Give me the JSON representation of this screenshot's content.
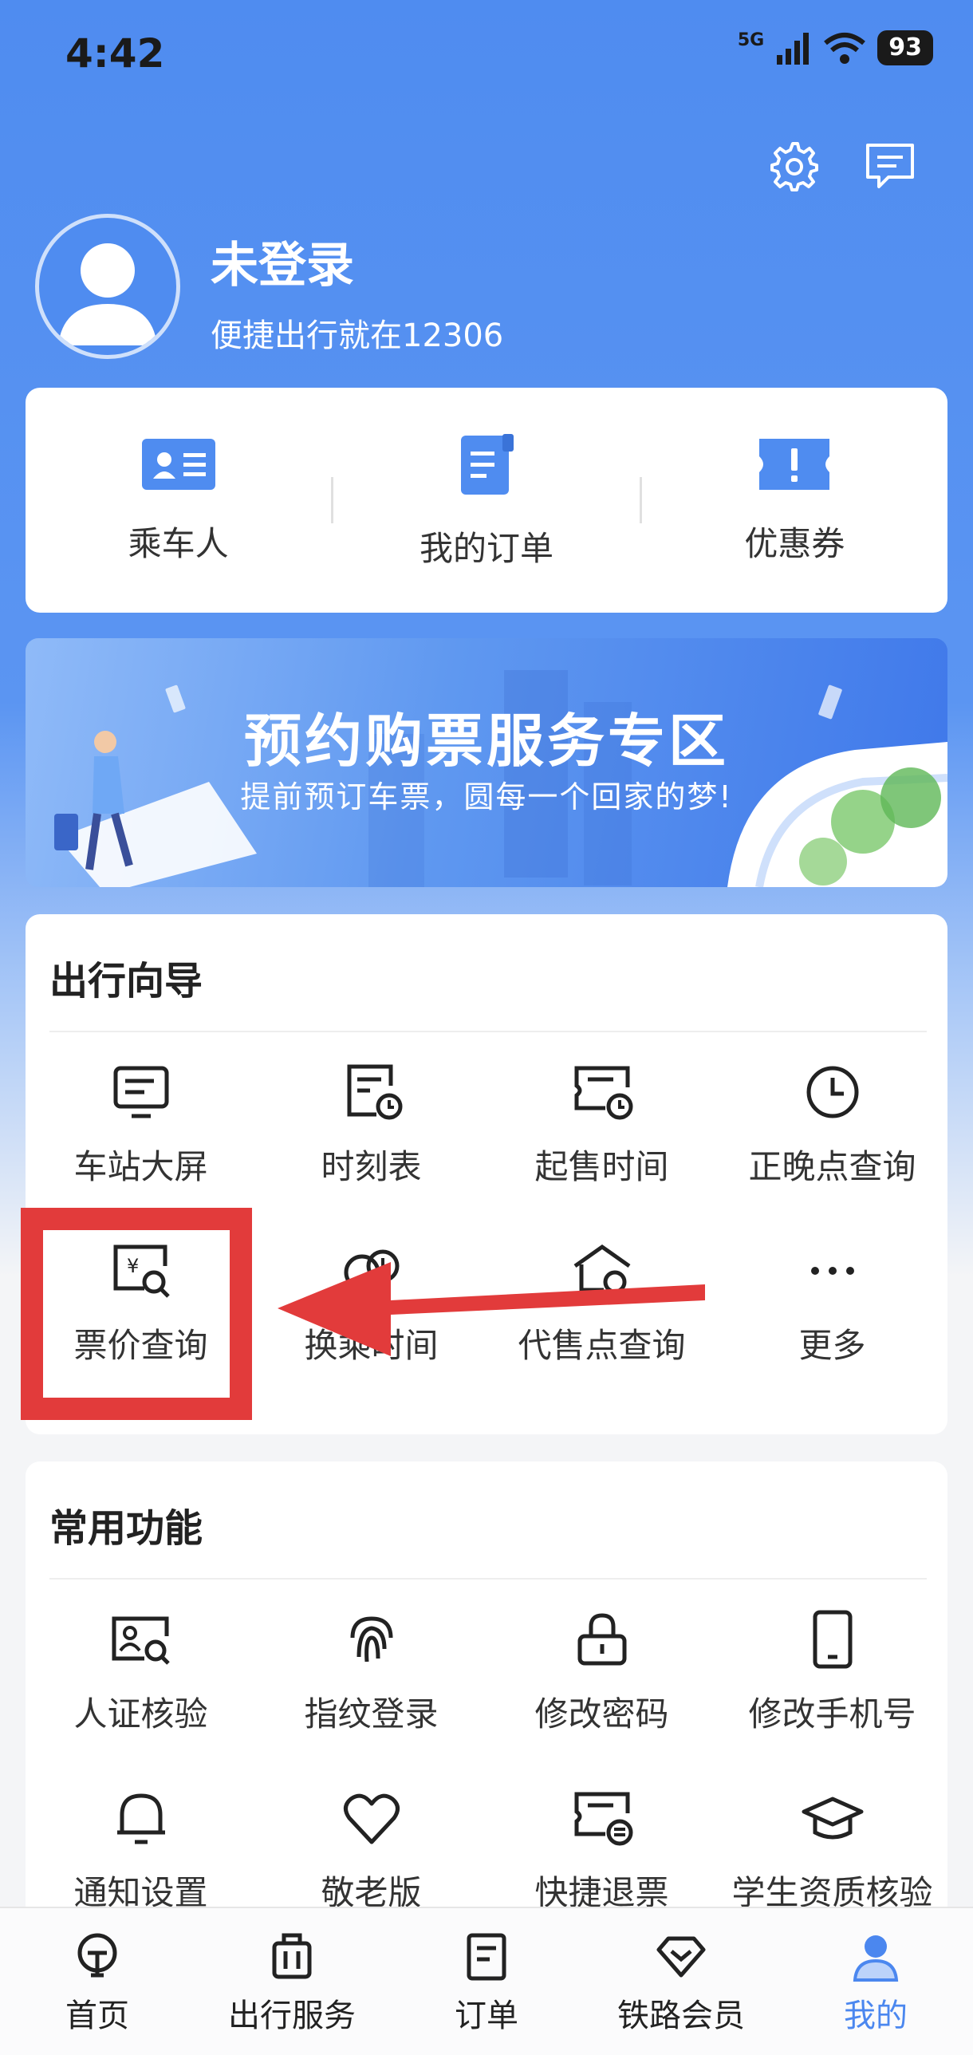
{
  "status_bar": {
    "time": "4:42",
    "network": "5G",
    "battery": "93"
  },
  "header": {
    "settings_icon": "gear-icon",
    "message_icon": "message-icon"
  },
  "profile": {
    "name": "未登录",
    "subtitle": "便捷出行就在12306"
  },
  "quick_actions": [
    {
      "label": "乘车人",
      "icon": "id-card-icon"
    },
    {
      "label": "我的订单",
      "icon": "order-doc-icon"
    },
    {
      "label": "优惠券",
      "icon": "coupon-icon"
    }
  ],
  "banner": {
    "title": "预约购票服务专区",
    "subtitle": "提前预订车票，圆每一个回家的梦!"
  },
  "travel_guide": {
    "title": "出行向导",
    "items": [
      {
        "label": "车站大屏",
        "icon": "screen-icon"
      },
      {
        "label": "时刻表",
        "icon": "timetable-icon"
      },
      {
        "label": "起售时间",
        "icon": "ticket-clock-icon"
      },
      {
        "label": "正晚点查询",
        "icon": "clock-icon"
      },
      {
        "label": "票价查询",
        "icon": "price-search-icon"
      },
      {
        "label": "换乘时间",
        "icon": "transfer-clock-icon"
      },
      {
        "label": "代售点查询",
        "icon": "outlet-search-icon"
      },
      {
        "label": "更多",
        "icon": "more-icon"
      }
    ]
  },
  "common_functions": {
    "title": "常用功能",
    "items": [
      {
        "label": "人证核验",
        "icon": "id-verify-icon"
      },
      {
        "label": "指纹登录",
        "icon": "fingerprint-icon"
      },
      {
        "label": "修改密码",
        "icon": "lock-icon"
      },
      {
        "label": "修改手机号",
        "icon": "phone-icon"
      },
      {
        "label": "通知设置",
        "icon": "bell-icon"
      },
      {
        "label": "敬老版",
        "icon": "heart-icon"
      },
      {
        "label": "快捷退票",
        "icon": "refund-ticket-icon"
      },
      {
        "label": "学生资质核验",
        "icon": "graduation-cap-icon"
      }
    ]
  },
  "bottom_nav": [
    {
      "label": "首页",
      "icon": "train-home-icon"
    },
    {
      "label": "出行服务",
      "icon": "luggage-icon"
    },
    {
      "label": "订单",
      "icon": "order-icon"
    },
    {
      "label": "铁路会员",
      "icon": "diamond-icon"
    },
    {
      "label": "我的",
      "icon": "user-icon",
      "active": true
    }
  ],
  "colors": {
    "primary": "#4f8cf0",
    "active_tab": "#4b87ef",
    "highlight": "#e23b3b"
  }
}
